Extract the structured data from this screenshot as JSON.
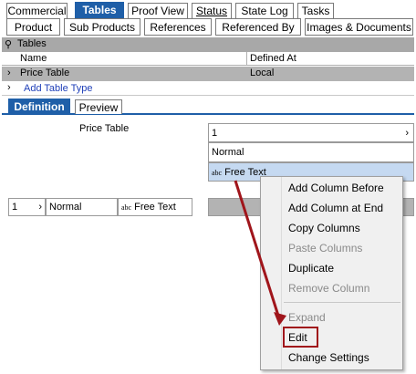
{
  "tabs_row1": [
    "Commercial",
    "Tables",
    "Proof View",
    "Status",
    "State Log",
    "Tasks"
  ],
  "tabs_row2": [
    "Product",
    "Sub Products",
    "References",
    "Referenced By",
    "Images & Documents"
  ],
  "tables_panel": {
    "title": "Tables",
    "col_name": "Name",
    "col_defined_at": "Defined At",
    "row_name": "Price Table",
    "row_defined_at": "Local",
    "add_link": "Add Table Type"
  },
  "sub_tabs": [
    "Definition",
    "Preview"
  ],
  "definition": {
    "table_title": "Price Table",
    "col_value": "1",
    "col_style": "Normal",
    "col_type": "Free Text",
    "row_value": "1",
    "row_style": "Normal",
    "row_type": "Free Text",
    "type_icon": "abc"
  },
  "context_menu": {
    "items": [
      {
        "label": "Add Column Before",
        "enabled": true
      },
      {
        "label": "Add Column at End",
        "enabled": true
      },
      {
        "label": "Copy Columns",
        "enabled": true
      },
      {
        "label": "Paste Columns",
        "enabled": false
      },
      {
        "label": "Duplicate",
        "enabled": true
      },
      {
        "label": "Remove Column",
        "enabled": false
      },
      {
        "label": "Expand",
        "enabled": false
      },
      {
        "label": "Edit",
        "enabled": true
      },
      {
        "label": "Change Settings",
        "enabled": true
      }
    ]
  },
  "colors": {
    "accent": "#1f5fa8",
    "arrow": "#a0151b",
    "header_gray": "#a8a8a8",
    "selection": "#c5d9f1"
  }
}
